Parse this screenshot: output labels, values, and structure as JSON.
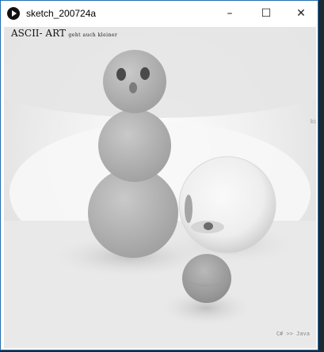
{
  "window": {
    "title": "sketch_200724a",
    "controls": {
      "minimize": "–",
      "maximize": "☐",
      "close": "✕"
    }
  },
  "canvas": {
    "title_main": "ASCII- ART",
    "title_tail": "geht auch kleiner",
    "brand": "C# >> Java",
    "edge_text": "ko",
    "scene": {
      "snowman": "snowman-figure",
      "mirror_ball": "mirror-sphere",
      "small_ball": "small-sphere"
    }
  }
}
